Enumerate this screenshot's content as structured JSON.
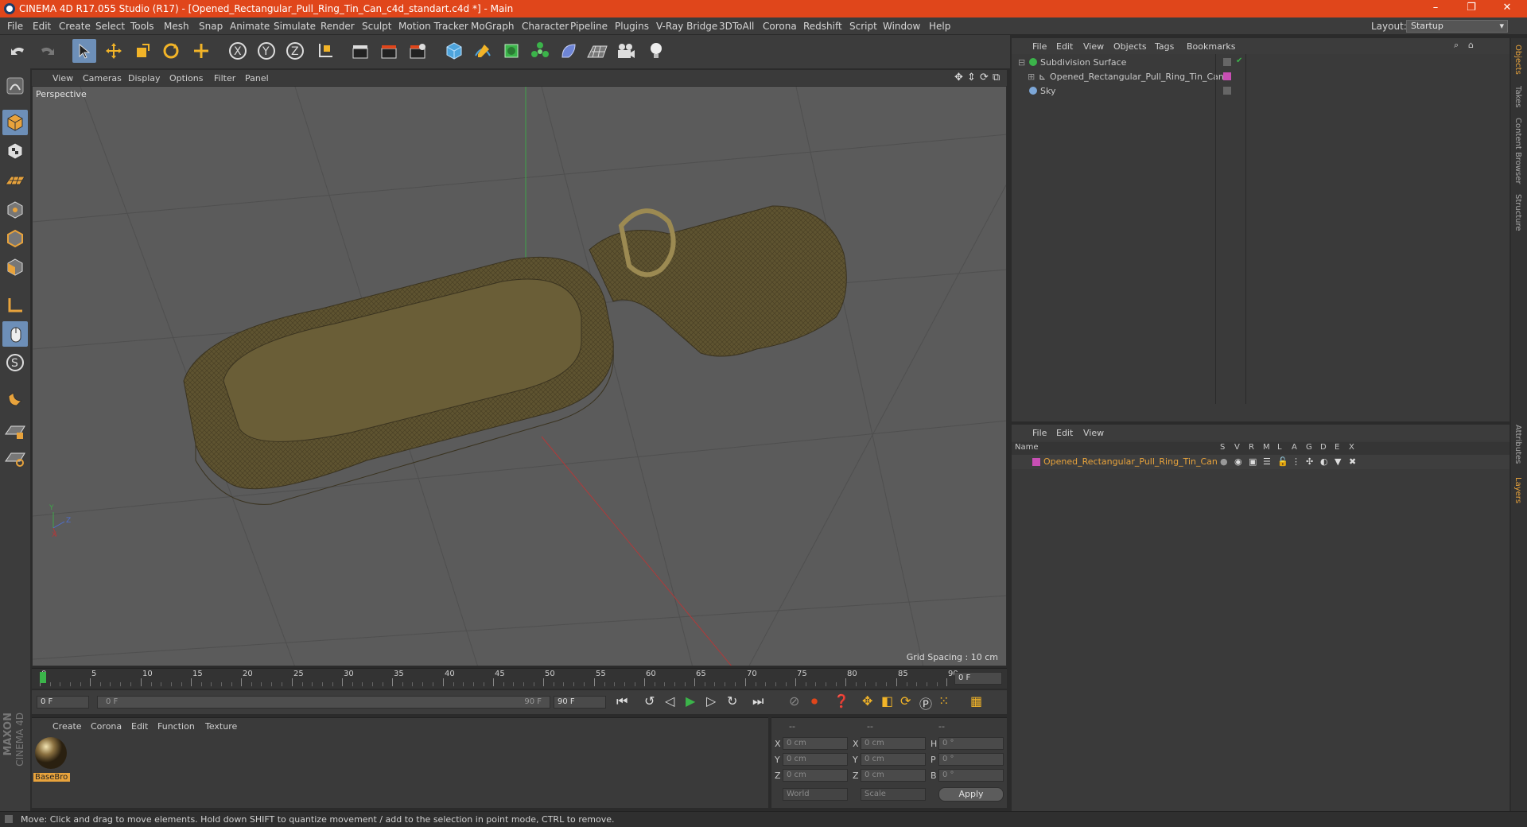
{
  "window": {
    "title": "CINEMA 4D R17.055 Studio (R17) - [Opened_Rectangular_Pull_Ring_Tin_Can_c4d_standart.c4d *] - Main",
    "controls": [
      "–",
      "❐",
      "✕"
    ]
  },
  "menubar": {
    "items": [
      "File",
      "Edit",
      "Create",
      "Select",
      "Tools",
      "Mesh",
      "Snap",
      "Animate",
      "Simulate",
      "Render",
      "Sculpt",
      "Motion Tracker",
      "MoGraph",
      "Character",
      "Pipeline",
      "Plugins",
      "V-Ray Bridge",
      "3DToAll",
      "Corona",
      "Redshift",
      "Script",
      "Window",
      "Help"
    ],
    "layout_label": "Layout:",
    "layout_value": "Startup"
  },
  "viewport": {
    "menu": [
      "View",
      "Cameras",
      "Display",
      "Options",
      "Filter",
      "Panel"
    ],
    "camera_label": "Perspective",
    "grid_spacing": "Grid Spacing : 10 cm",
    "axis_labels": [
      "Y",
      "Z",
      "X"
    ]
  },
  "timeline": {
    "ticks": [
      "0",
      "5",
      "10",
      "15",
      "20",
      "25",
      "30",
      "35",
      "40",
      "45",
      "50",
      "55",
      "60",
      "65",
      "70",
      "75",
      "80",
      "85",
      "90"
    ],
    "current_frame": "0 F"
  },
  "playback": {
    "start_field": "0 F",
    "range_start": "0 F",
    "range_end": "90 F",
    "end_field": "90 F"
  },
  "materials": {
    "menu": [
      "Create",
      "Corona",
      "Edit",
      "Function",
      "Texture"
    ],
    "items": [
      {
        "name": "BaseBro"
      }
    ]
  },
  "coordinates": {
    "headers": [
      "--",
      "--",
      "--"
    ],
    "rows": [
      {
        "pos_axis": "X",
        "pos": "0 cm",
        "size_axis": "X",
        "size": "0 cm",
        "rot_axis": "H",
        "rot": "0 °"
      },
      {
        "pos_axis": "Y",
        "pos": "0 cm",
        "size_axis": "Y",
        "size": "0 cm",
        "rot_axis": "P",
        "rot": "0 °"
      },
      {
        "pos_axis": "Z",
        "pos": "0 cm",
        "size_axis": "Z",
        "size": "0 cm",
        "rot_axis": "B",
        "rot": "0 °"
      }
    ],
    "mode_world": "World",
    "mode_scale": "Scale",
    "apply": "Apply"
  },
  "objects": {
    "menu": [
      "File",
      "Edit",
      "View",
      "Objects",
      "Tags",
      "Bookmarks"
    ],
    "items": [
      {
        "name": "Subdivision Surface",
        "indent": 0
      },
      {
        "name": "Opened_Rectangular_Pull_Ring_Tin_Can",
        "indent": 1
      },
      {
        "name": "Sky",
        "indent": 0
      }
    ]
  },
  "layers": {
    "menu": [
      "File",
      "Edit",
      "View"
    ],
    "columns": [
      "Name",
      "S",
      "V",
      "R",
      "M",
      "L",
      "A",
      "G",
      "D",
      "E",
      "X"
    ],
    "rows": [
      {
        "name": "Opened_Rectangular_Pull_Ring_Tin_Can",
        "color": "#c84fb4"
      }
    ]
  },
  "right_tabs": [
    "Objects",
    "Takes",
    "Content Browser",
    "Structure",
    "Attributes",
    "Layers"
  ],
  "status": "Move: Click and drag to move elements. Hold down SHIFT to quantize movement / add to the selection in point mode, CTRL to remove.",
  "brand": {
    "line1": "MAXON",
    "line2": "CINEMA 4D"
  },
  "colors": {
    "accent": "#e0461b",
    "active_tool": "#6d8fb8",
    "layer_name": "#e8a33c",
    "can_model": "#5e5330"
  }
}
